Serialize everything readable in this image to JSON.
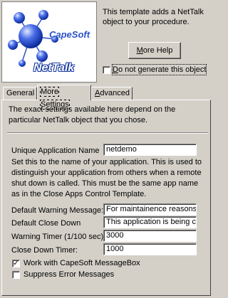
{
  "logo": {
    "brand": "CapeSoft",
    "product": "NetTalk"
  },
  "header": {
    "description": "This template adds a NetTalk object to your procedure.",
    "more_help_label": "More Help",
    "do_not_generate_label": "Do not generate this object",
    "do_not_generate_checked": false
  },
  "tabs": [
    {
      "label": "General",
      "active": false
    },
    {
      "label": "More Settings",
      "active": true
    },
    {
      "label": "Advanced",
      "active": false
    }
  ],
  "panel": {
    "intro": "The exact settings available here depend on the particular NetTalk object that you chose.",
    "unique_app_label": "Unique Application Name",
    "unique_app_value": "netdemo",
    "unique_app_help": "Set this to the name of your application. This is used to distinguish your application from others when a remote shut down is called. This must be the same app name as in the Close Apps Control Template.",
    "default_warning_label": "Default Warning Message:",
    "default_warning_value": "For maintainence reasons",
    "default_close_label": "Default Close Down",
    "default_close_value": "This application is being cl",
    "warning_timer_label": "Warning Timer (1/100 sec):",
    "warning_timer_value": "3000",
    "close_timer_label": "Close Down Timer:",
    "close_timer_value": "1000",
    "messagebox_label": "Work with CapeSoft MessageBox",
    "messagebox_checked": true,
    "suppress_label": "Suppress Error Messages",
    "suppress_checked": false
  },
  "colors": {
    "face": "#d4d0c8",
    "shadow": "#808080",
    "logo_blue": "#2a52c8"
  }
}
